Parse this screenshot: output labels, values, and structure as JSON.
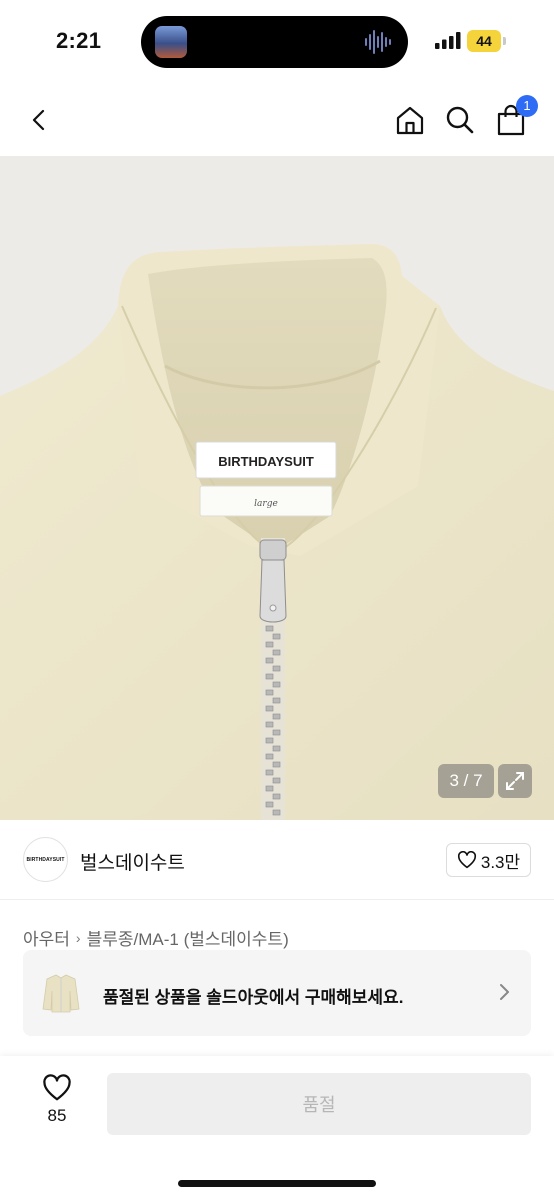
{
  "status_bar": {
    "time": "2:21",
    "battery": "44",
    "battery_color": "#f5d33b"
  },
  "nav": {
    "back_icon": "chevron-left-icon",
    "home_icon": "home-icon",
    "search_icon": "search-icon",
    "cart_icon": "shopping-bag-icon",
    "cart_count": "1",
    "badge_color": "#2f6cf6"
  },
  "product_image": {
    "label_brand": "BIRTHDAYSUIT",
    "label_size": "large",
    "counter": "3 / 7",
    "expand_icon": "expand-icon"
  },
  "brand": {
    "logo_text": "BIRTHDAYSUIT",
    "name": "벌스데이수트",
    "likes": "3.3만"
  },
  "breadcrumb": {
    "category": "아우터",
    "sub": "블루종/MA-1 (벌스데이수트)"
  },
  "soldout_banner": {
    "text": "품절된 상품을 솔드아웃에서 구매해보세요."
  },
  "bottom_bar": {
    "wish_count": "85",
    "buy_label": "품절"
  }
}
